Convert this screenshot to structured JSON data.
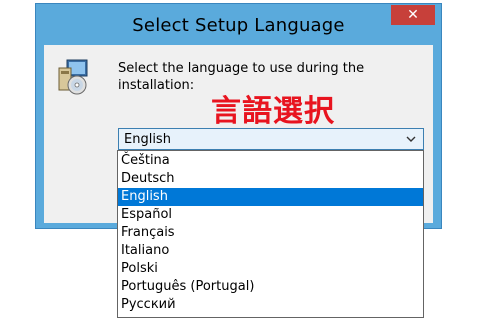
{
  "window": {
    "title": "Select Setup Language",
    "close_glyph": "✕"
  },
  "icons": {
    "setup": "setup-icon",
    "close": "close-icon",
    "dropdown": "chevron-down-icon"
  },
  "prompt": {
    "text": "Select the language to use during the installation:"
  },
  "annotation": {
    "text": "言語選択",
    "color": "#e8141f"
  },
  "language_select": {
    "selected": "English",
    "options": [
      "Čeština",
      "Deutsch",
      "English",
      "Español",
      "Français",
      "Italiano",
      "Polski",
      "Português (Portugal)",
      "Русский"
    ],
    "highlighted_index": 2
  },
  "colors": {
    "titlebar": "#5aaadc",
    "close_button": "#c7403a",
    "selection": "#0078d7"
  }
}
